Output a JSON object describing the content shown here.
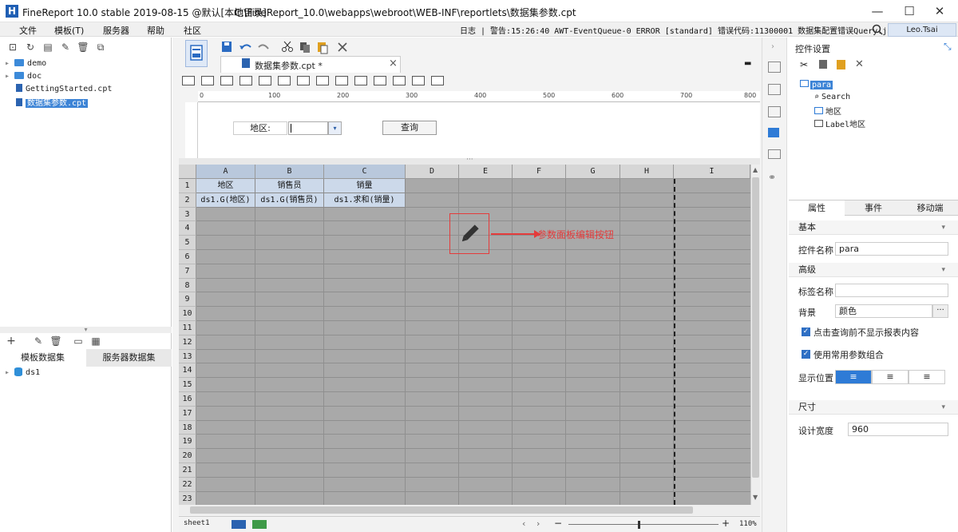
{
  "window": {
    "title": "FineReport 10.0 stable 2019-08-15 @默认[本地目录]",
    "path": "C:\\FineReport_10.0\\webapps\\webroot\\WEB-INF\\reportlets\\数据集参数.cpt",
    "minimize": "—",
    "maximize": "☐",
    "close": "✕"
  },
  "menu": [
    "文件",
    "模板(T)",
    "服务器",
    "帮助",
    "社区"
  ],
  "log": "日志 | 警告:15:26:40 AWT-EventQueue-0 ERROR [standard] 错误代码:11300001 数据集配置错误Query:java...",
  "user": "Leo.Tsai",
  "file_tree": [
    {
      "name": "demo",
      "type": "folder"
    },
    {
      "name": "doc",
      "type": "folder"
    },
    {
      "name": "GettingStarted.cpt",
      "type": "file"
    },
    {
      "name": "数据集参数.cpt",
      "type": "file",
      "selected": true
    }
  ],
  "dataset_tabs": [
    "模板数据集",
    "服务器数据集"
  ],
  "datasets": [
    "ds1"
  ],
  "editor_tab": {
    "label": "数据集参数.cpt *",
    "close": "×"
  },
  "ruler_ticks": [
    "0",
    "100",
    "200",
    "300",
    "400",
    "500",
    "600",
    "700",
    "800"
  ],
  "param_panel": {
    "label": "地区:",
    "query_button": "查询"
  },
  "columns": [
    "A",
    "B",
    "C",
    "D",
    "E",
    "F",
    "G",
    "H",
    "I"
  ],
  "rows": [
    "1",
    "2",
    "3",
    "4",
    "5",
    "6",
    "7",
    "8",
    "9",
    "10",
    "11",
    "12",
    "13",
    "14",
    "15",
    "16",
    "17",
    "18",
    "19",
    "20",
    "21",
    "22",
    "23"
  ],
  "cells": {
    "header": [
      "地区",
      "销售员",
      "销量"
    ],
    "row2": [
      "ds1.G(地区)",
      "ds1.G(销售员)",
      "ds1.求和(销量)"
    ]
  },
  "annotation": "参数面板编辑按钮",
  "sheet": "sheet1",
  "zoom": "110%",
  "right_panel": {
    "title": "控件设置",
    "tree": [
      "para",
      "Search",
      "地区",
      "Label地区"
    ],
    "tabs": [
      "属性",
      "事件",
      "移动端"
    ],
    "sections": {
      "basic": "基本",
      "advanced": "高级",
      "size": "尺寸"
    },
    "widget_name_label": "控件名称",
    "widget_name": "para",
    "tag_name_label": "标签名称",
    "background_label": "背景",
    "background_value": "颜色",
    "background_more": "···",
    "check1": "点击查询前不显示报表内容",
    "check2": "使用常用参数组合",
    "position_label": "显示位置",
    "design_width_label": "设计宽度",
    "design_width": "960"
  },
  "colors": {
    "accent": "#2e7bd6",
    "annotation": "#e53b3b",
    "selected_cells": "#ccd9ea"
  }
}
